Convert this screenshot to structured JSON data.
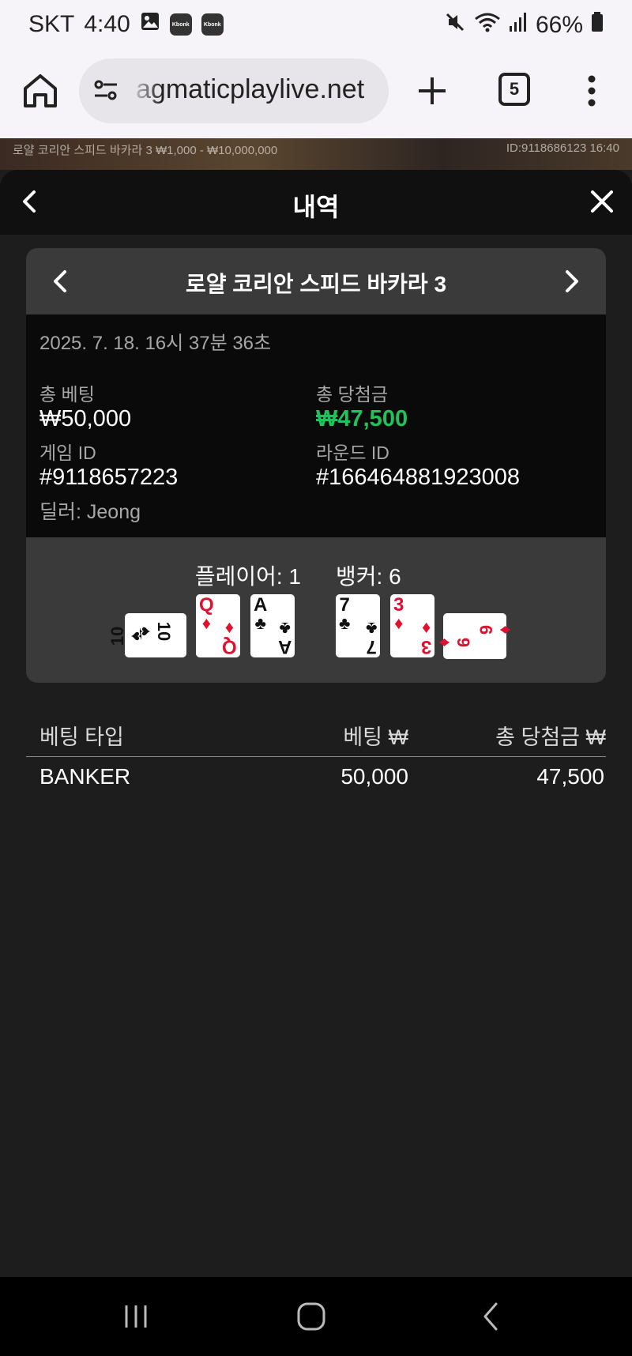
{
  "status_bar": {
    "carrier": "SKT",
    "time": "4:40",
    "notif_icons": [
      "image-icon",
      "Kbonk",
      "Kbonk"
    ],
    "battery": "66%"
  },
  "browser": {
    "url": "agmaticplaylive.net",
    "tab_count": "5"
  },
  "game_strip": {
    "left_text": "로얄 코리안 스피드 바카라 3  ₩1,000 - ₩10,000,000",
    "right_text": "ID:9118686123  16:40"
  },
  "modal": {
    "title": "내역",
    "game_name": "로얄 코리안 스피드 바카라 3",
    "datetime": "2025. 7. 18. 16시 37분 36초",
    "total_bet_label": "총 베팅",
    "total_bet_value": "₩50,000",
    "total_win_label": "총 당첨금",
    "total_win_value": "₩47,500",
    "game_id_label": "게임 ID",
    "game_id_value": "#9118657223",
    "round_id_label": "라운드 ID",
    "round_id_value": "#166464881923008",
    "dealer": "딜러: Jeong",
    "player_score": "플레이어: 1",
    "banker_score": "뱅커: 6",
    "player_cards": [
      {
        "rank": "10",
        "suit": "♠",
        "color": "black",
        "orientation": "sideways"
      },
      {
        "rank": "Q",
        "suit": "♦",
        "color": "red",
        "orientation": "upright"
      },
      {
        "rank": "A",
        "suit": "♣",
        "color": "black",
        "orientation": "upright"
      }
    ],
    "banker_cards": [
      {
        "rank": "7",
        "suit": "♣",
        "color": "black",
        "orientation": "upright"
      },
      {
        "rank": "3",
        "suit": "♦",
        "color": "red",
        "orientation": "upright"
      },
      {
        "rank": "9",
        "suit": "♦",
        "color": "red",
        "orientation": "sideways"
      }
    ],
    "table": {
      "headers": [
        "베팅 타입",
        "베팅 ₩",
        "총 당첨금 ₩"
      ],
      "rows": [
        {
          "type": "BANKER",
          "bet": "50,000",
          "win": "47,500"
        }
      ]
    }
  },
  "colors": {
    "win_green": "#21c15b",
    "card_red": "#e0102e",
    "modal_bg": "#1d1d1d"
  }
}
